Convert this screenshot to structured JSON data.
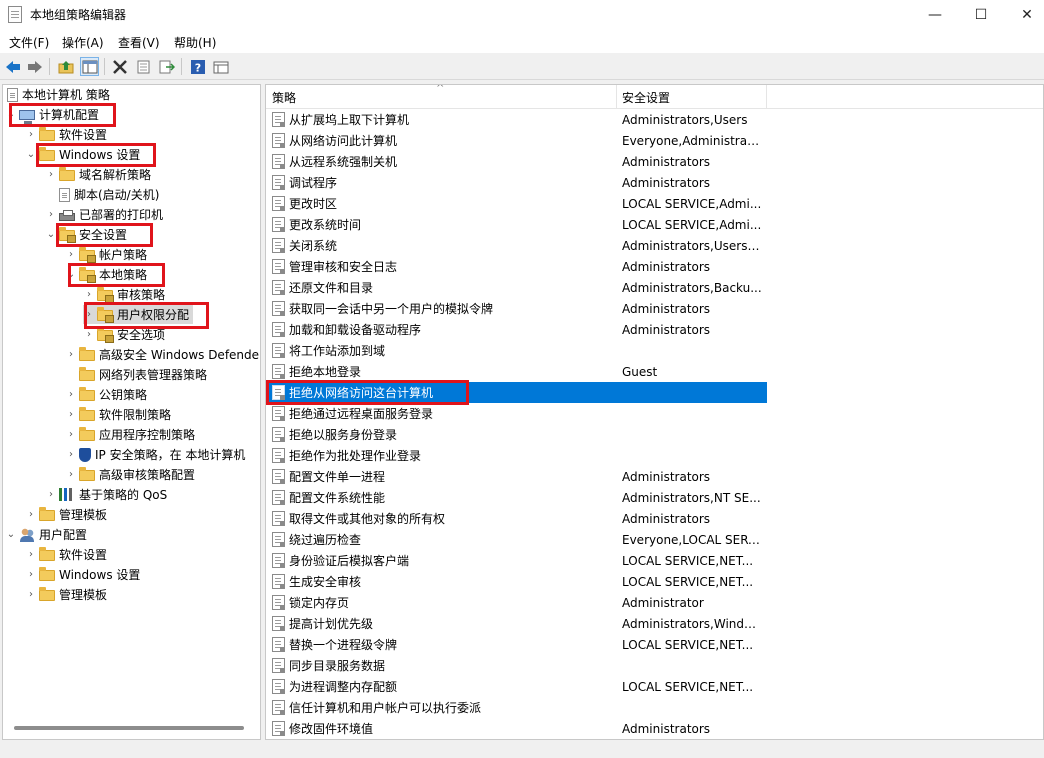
{
  "window": {
    "title": "本地组策略编辑器",
    "minimize": "—",
    "maximize": "☐",
    "close": "✕"
  },
  "menu": [
    "文件(F)",
    "操作(A)",
    "查看(V)",
    "帮助(H)"
  ],
  "toolbar": [
    "back-icon",
    "forward-icon",
    "up-folder-icon",
    "show-hide-tree-icon",
    "delete-icon",
    "properties-icon",
    "export-icon",
    "help-icon",
    "view-icon"
  ],
  "tree": {
    "root": "本地计算机 策略",
    "items": [
      {
        "label": "计算机配置",
        "icon": "computer"
      },
      {
        "label": "软件设置",
        "icon": "folder"
      },
      {
        "label": "Windows 设置",
        "icon": "folder"
      },
      {
        "label": "域名解析策略",
        "icon": "folder"
      },
      {
        "label": "脚本(启动/关机)",
        "icon": "script"
      },
      {
        "label": "已部署的打印机",
        "icon": "printer"
      },
      {
        "label": "安全设置",
        "icon": "lock-folder"
      },
      {
        "label": "帐户策略",
        "icon": "lock-folder"
      },
      {
        "label": "本地策略",
        "icon": "lock-folder"
      },
      {
        "label": "审核策略",
        "icon": "lock-folder"
      },
      {
        "label": "用户权限分配",
        "icon": "lock-folder"
      },
      {
        "label": "安全选项",
        "icon": "lock-folder"
      },
      {
        "label": "高级安全 Windows Defende",
        "icon": "folder"
      },
      {
        "label": "网络列表管理器策略",
        "icon": "folder"
      },
      {
        "label": "公钥策略",
        "icon": "folder"
      },
      {
        "label": "软件限制策略",
        "icon": "folder"
      },
      {
        "label": "应用程序控制策略",
        "icon": "folder"
      },
      {
        "label": "IP 安全策略，在 本地计算机",
        "icon": "shield"
      },
      {
        "label": "高级审核策略配置",
        "icon": "folder"
      },
      {
        "label": "基于策略的 QoS",
        "icon": "chart"
      },
      {
        "label": "管理模板",
        "icon": "folder"
      },
      {
        "label": "用户配置",
        "icon": "users"
      },
      {
        "label": "软件设置",
        "icon": "folder"
      },
      {
        "label": "Windows 设置",
        "icon": "folder"
      },
      {
        "label": "管理模板",
        "icon": "folder"
      }
    ]
  },
  "list": {
    "col_policy": "策略",
    "col_setting": "安全设置",
    "rows": [
      {
        "policy": "从扩展坞上取下计算机",
        "setting": "Administrators,Users"
      },
      {
        "policy": "从网络访问此计算机",
        "setting": "Everyone,Administrat..."
      },
      {
        "policy": "从远程系统强制关机",
        "setting": "Administrators"
      },
      {
        "policy": "调试程序",
        "setting": "Administrators"
      },
      {
        "policy": "更改时区",
        "setting": "LOCAL SERVICE,Admi..."
      },
      {
        "policy": "更改系统时间",
        "setting": "LOCAL SERVICE,Admi..."
      },
      {
        "policy": "关闭系统",
        "setting": "Administrators,Users,..."
      },
      {
        "policy": "管理审核和安全日志",
        "setting": "Administrators"
      },
      {
        "policy": "还原文件和目录",
        "setting": "Administrators,Backu..."
      },
      {
        "policy": "获取同一会话中另一个用户的模拟令牌",
        "setting": "Administrators"
      },
      {
        "policy": "加载和卸载设备驱动程序",
        "setting": "Administrators"
      },
      {
        "policy": "将工作站添加到域",
        "setting": ""
      },
      {
        "policy": "拒绝本地登录",
        "setting": "Guest"
      },
      {
        "policy": "拒绝从网络访问这台计算机",
        "setting": ""
      },
      {
        "policy": "拒绝通过远程桌面服务登录",
        "setting": ""
      },
      {
        "policy": "拒绝以服务身份登录",
        "setting": ""
      },
      {
        "policy": "拒绝作为批处理作业登录",
        "setting": ""
      },
      {
        "policy": "配置文件单一进程",
        "setting": "Administrators"
      },
      {
        "policy": "配置文件系统性能",
        "setting": "Administrators,NT SE..."
      },
      {
        "policy": "取得文件或其他对象的所有权",
        "setting": "Administrators"
      },
      {
        "policy": "绕过遍历检查",
        "setting": "Everyone,LOCAL SERV..."
      },
      {
        "policy": "身份验证后模拟客户端",
        "setting": "LOCAL SERVICE,NET..."
      },
      {
        "policy": "生成安全审核",
        "setting": "LOCAL SERVICE,NET..."
      },
      {
        "policy": "锁定内存页",
        "setting": "Administrator"
      },
      {
        "policy": "提高计划优先级",
        "setting": "Administrators,Windo..."
      },
      {
        "policy": "替换一个进程级令牌",
        "setting": "LOCAL SERVICE,NET..."
      },
      {
        "policy": "同步目录服务数据",
        "setting": ""
      },
      {
        "policy": "为进程调整内存配额",
        "setting": "LOCAL SERVICE,NET..."
      },
      {
        "policy": "信任计算机和用户帐户可以执行委派",
        "setting": ""
      },
      {
        "policy": "修改固件环境值",
        "setting": "Administrators"
      }
    ]
  },
  "colors": {
    "selection": "#0078d7",
    "highlight_box": "#e0141b"
  }
}
